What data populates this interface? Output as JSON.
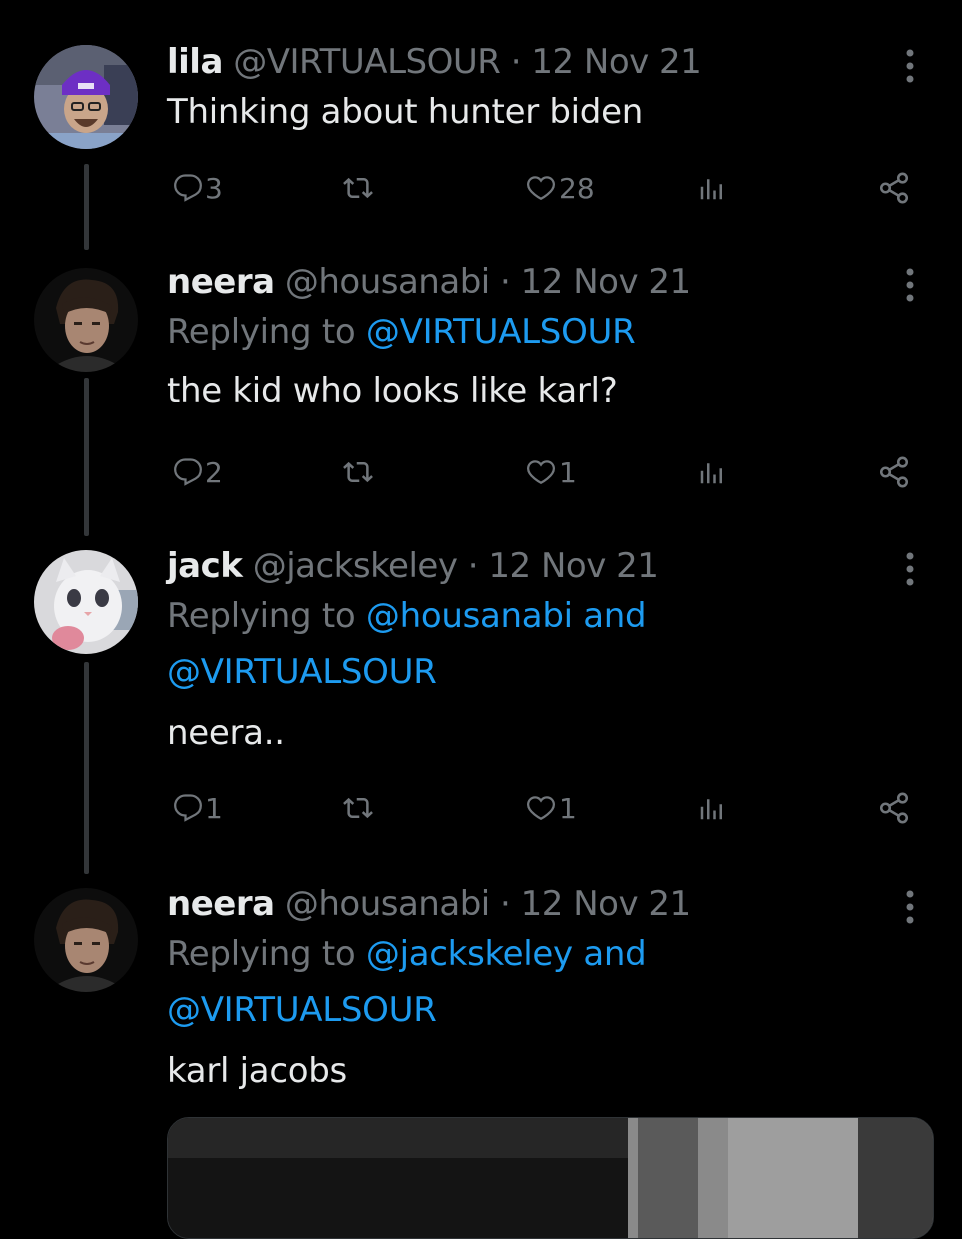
{
  "colors": {
    "background": "#000000",
    "primary_text": "#e7e9ea",
    "secondary_text": "#71767b",
    "accent": "#1d9bf0",
    "thread_line": "#333639"
  },
  "tweets": [
    {
      "name": "lila",
      "handle": "@VIRTUALSOUR",
      "separator": "·",
      "date": "12 Nov 21",
      "replying_prefix": "",
      "replying_mentions": [],
      "text": "Thinking about hunter biden",
      "replies": "3",
      "likes": "28"
    },
    {
      "name": "neera",
      "handle": "@housanabi",
      "separator": "·",
      "date": "12 Nov 21",
      "replying_prefix": "Replying to",
      "replying_line1": "@VIRTUALSOUR",
      "text": "the kid who looks like karl?",
      "replies": "2",
      "likes": "1"
    },
    {
      "name": "jack",
      "handle": "@jackskeley",
      "separator": "·",
      "date": "12 Nov 21",
      "replying_prefix": "Replying to",
      "replying_line1": "@housanabi and",
      "replying_line2": "@VIRTUALSOUR",
      "text": "neera..",
      "replies": "1",
      "likes": "1"
    },
    {
      "name": "neera",
      "handle": "@housanabi",
      "separator": "·",
      "date": "12 Nov 21",
      "replying_prefix": "Replying to",
      "replying_line1": "@jackskeley and",
      "replying_line2": "@VIRTUALSOUR",
      "text": "karl jacobs"
    }
  ],
  "icons": {
    "reply": "reply-icon",
    "retweet": "retweet-icon",
    "like": "heart-icon",
    "views": "analytics-icon",
    "share": "share-icon",
    "more": "more-options-icon"
  }
}
